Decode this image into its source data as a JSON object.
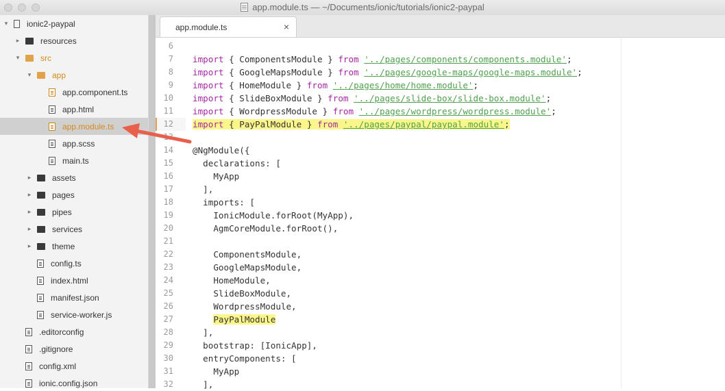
{
  "window": {
    "title": "app.module.ts — ~/Documents/ionic/tutorials/ionic2-paypal"
  },
  "sidebar": {
    "items": [
      {
        "label": "ionic2-paypal",
        "kind": "repo",
        "depth": 0,
        "caret": "▾"
      },
      {
        "label": "resources",
        "kind": "folder",
        "depth": 1,
        "caret": "▸"
      },
      {
        "label": "src",
        "kind": "folder-open",
        "depth": 1,
        "caret": "▾"
      },
      {
        "label": "app",
        "kind": "folder-open",
        "depth": 2,
        "caret": "▾"
      },
      {
        "label": "app.component.ts",
        "kind": "file-ts",
        "depth": 3
      },
      {
        "label": "app.html",
        "kind": "file",
        "depth": 3
      },
      {
        "label": "app.module.ts",
        "kind": "file-ts",
        "depth": 3,
        "selected": true
      },
      {
        "label": "app.scss",
        "kind": "file",
        "depth": 3
      },
      {
        "label": "main.ts",
        "kind": "file",
        "depth": 3
      },
      {
        "label": "assets",
        "kind": "folder",
        "depth": 2,
        "caret": "▸"
      },
      {
        "label": "pages",
        "kind": "folder",
        "depth": 2,
        "caret": "▸"
      },
      {
        "label": "pipes",
        "kind": "folder",
        "depth": 2,
        "caret": "▸"
      },
      {
        "label": "services",
        "kind": "folder",
        "depth": 2,
        "caret": "▸"
      },
      {
        "label": "theme",
        "kind": "folder",
        "depth": 2,
        "caret": "▸"
      },
      {
        "label": "config.ts",
        "kind": "file",
        "depth": 2
      },
      {
        "label": "index.html",
        "kind": "file",
        "depth": 2
      },
      {
        "label": "manifest.json",
        "kind": "file",
        "depth": 2
      },
      {
        "label": "service-worker.js",
        "kind": "file",
        "depth": 2
      },
      {
        "label": ".editorconfig",
        "kind": "file",
        "depth": 1
      },
      {
        "label": ".gitignore",
        "kind": "file",
        "depth": 1
      },
      {
        "label": "config.xml",
        "kind": "file",
        "depth": 1
      },
      {
        "label": "ionic.config.json",
        "kind": "file",
        "depth": 1
      }
    ]
  },
  "tabs": [
    {
      "label": "app.module.ts",
      "close": "×"
    }
  ],
  "editor": {
    "lines": [
      {
        "n": "6",
        "code": ""
      },
      {
        "n": "7",
        "kw1": "import",
        "mid": " { ComponentsModule } ",
        "kw2": "from",
        "sp": " ",
        "str": "'../pages/components/components.module'",
        "end": ";"
      },
      {
        "n": "8",
        "kw1": "import",
        "mid": " { GoogleMapsModule } ",
        "kw2": "from",
        "sp": " ",
        "str": "'../pages/google-maps/google-maps.module'",
        "end": ";"
      },
      {
        "n": "9",
        "kw1": "import",
        "mid": " { HomeModule } ",
        "kw2": "from",
        "sp": " ",
        "str": "'../pages/home/home.module'",
        "end": ";"
      },
      {
        "n": "10",
        "kw1": "import",
        "mid": " { SlideBoxModule } ",
        "kw2": "from",
        "sp": " ",
        "str": "'../pages/slide-box/slide-box.module'",
        "end": ";"
      },
      {
        "n": "11",
        "kw1": "import",
        "mid": " { WordpressModule } ",
        "kw2": "from",
        "sp": " ",
        "str": "'../pages/wordpress/wordpress.module'",
        "end": ";"
      },
      {
        "n": "12",
        "kw1": "import",
        "mid": " { PayPalModule } ",
        "kw2": "from",
        "sp": " ",
        "str": "'../pages/paypal/paypal.module'",
        "end": ";",
        "highlight": true
      },
      {
        "n": "13",
        "code": ""
      },
      {
        "n": "14",
        "code": "@NgModule({"
      },
      {
        "n": "15",
        "code": "  declarations: ["
      },
      {
        "n": "16",
        "code": "    MyApp"
      },
      {
        "n": "17",
        "code": "  ],"
      },
      {
        "n": "18",
        "code": "  imports: ["
      },
      {
        "n": "19",
        "code": "    IonicModule.forRoot(MyApp),"
      },
      {
        "n": "20",
        "code": "    AgmCoreModule.forRoot(),"
      },
      {
        "n": "21",
        "code": ""
      },
      {
        "n": "22",
        "code": "    ComponentsModule,"
      },
      {
        "n": "23",
        "code": "    GoogleMapsModule,"
      },
      {
        "n": "24",
        "code": "    HomeModule,"
      },
      {
        "n": "25",
        "code": "    SlideBoxModule,"
      },
      {
        "n": "26",
        "code": "    WordpressModule,"
      },
      {
        "n": "27",
        "indent": "    ",
        "hlcode": "PayPalModule"
      },
      {
        "n": "28",
        "code": "  ],"
      },
      {
        "n": "29",
        "code": "  bootstrap: [IonicApp],"
      },
      {
        "n": "30",
        "code": "  entryComponents: ["
      },
      {
        "n": "31",
        "code": "    MyApp"
      },
      {
        "n": "32",
        "code": "  ],"
      }
    ]
  },
  "colors": {
    "accent": "#e2a24a",
    "arrow": "#e8604c",
    "highlight": "#fbf68a",
    "keyword": "#a626a4",
    "string": "#50a14f"
  }
}
